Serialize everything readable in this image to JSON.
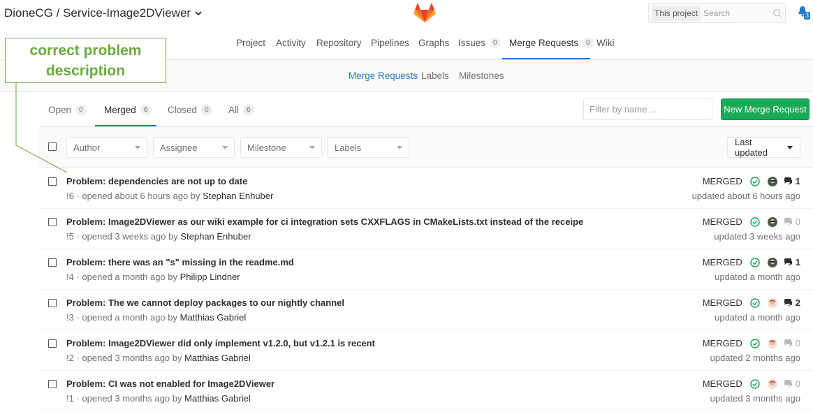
{
  "header": {
    "project_title": "DioneCG / Service-Image2DViewer",
    "search_scope": "This project",
    "search_placeholder": "Search",
    "notification_count": "3"
  },
  "project_nav": [
    {
      "label": "Project"
    },
    {
      "label": "Activity"
    },
    {
      "label": "Repository"
    },
    {
      "label": "Pipelines"
    },
    {
      "label": "Graphs"
    },
    {
      "label": "Issues",
      "count": "0"
    },
    {
      "label": "Merge Requests",
      "count": "0",
      "active": true
    },
    {
      "label": "Wiki"
    }
  ],
  "sub_nav": [
    {
      "label": "Merge Requests",
      "active": true
    },
    {
      "label": "Labels"
    },
    {
      "label": "Milestones"
    }
  ],
  "annotation": {
    "text_line1": "correct problem",
    "text_line2": "description",
    "color": "#6aab3e"
  },
  "tabs": [
    {
      "label": "Open",
      "count": "0"
    },
    {
      "label": "Merged",
      "count": "6",
      "active": true
    },
    {
      "label": "Closed",
      "count": "0"
    },
    {
      "label": "All",
      "count": "6"
    }
  ],
  "filter_placeholder": "Filter by name ...",
  "new_mr_label": "New Merge Request",
  "filters": {
    "author": "Author",
    "assignee": "Assignee",
    "milestone": "Milestone",
    "labels": "Labels"
  },
  "sort_label": "Last updated",
  "merge_requests": [
    {
      "title": "Problem: dependencies are not up to date",
      "meta": "!6 · opened about 6 hours ago by ",
      "author": "Stephan Enhuber",
      "status": "MERGED",
      "comments": "1",
      "updated": "updated about 6 hours ago",
      "avatar": "dark"
    },
    {
      "title": "Problem: Image2DViewer as our wiki example for ci integration sets CXXFLAGS in CMakeLists.txt instead of the receipe",
      "meta": "!5 · opened 3 weeks ago by ",
      "author": "Stephan Enhuber",
      "status": "MERGED",
      "comments": "0",
      "updated": "updated 3 weeks ago",
      "avatar": "dark"
    },
    {
      "title": "Problem: there was an \"s\" missing in the readme.md",
      "meta": "!4 · opened a month ago by ",
      "author": "Philipp Lindner",
      "status": "MERGED",
      "comments": "1",
      "updated": "updated a month ago",
      "avatar": "dark"
    },
    {
      "title": "Problem: The we cannot deploy packages to our nightly channel",
      "meta": "!3 · opened a month ago by ",
      "author": "Matthias Gabriel",
      "status": "MERGED",
      "comments": "2",
      "updated": "updated a month ago",
      "avatar": "light"
    },
    {
      "title": "Problem: Image2DViewer did only implement v1.2.0, but v1.2.1 is recent",
      "meta": "!2 · opened 3 months ago by ",
      "author": "Matthias Gabriel",
      "status": "MERGED",
      "comments": "0",
      "updated": "updated 2 months ago",
      "avatar": "light"
    },
    {
      "title": "Problem: CI was not enabled for Image2DViewer",
      "meta": "!1 · opened 3 months ago by ",
      "author": "Matthias Gabriel",
      "status": "MERGED",
      "comments": "0",
      "updated": "updated 3 months ago",
      "avatar": "light"
    }
  ],
  "colors": {
    "accent": "#1f78d1",
    "success": "#1aaa55",
    "merged_check": "#1aaa55"
  }
}
